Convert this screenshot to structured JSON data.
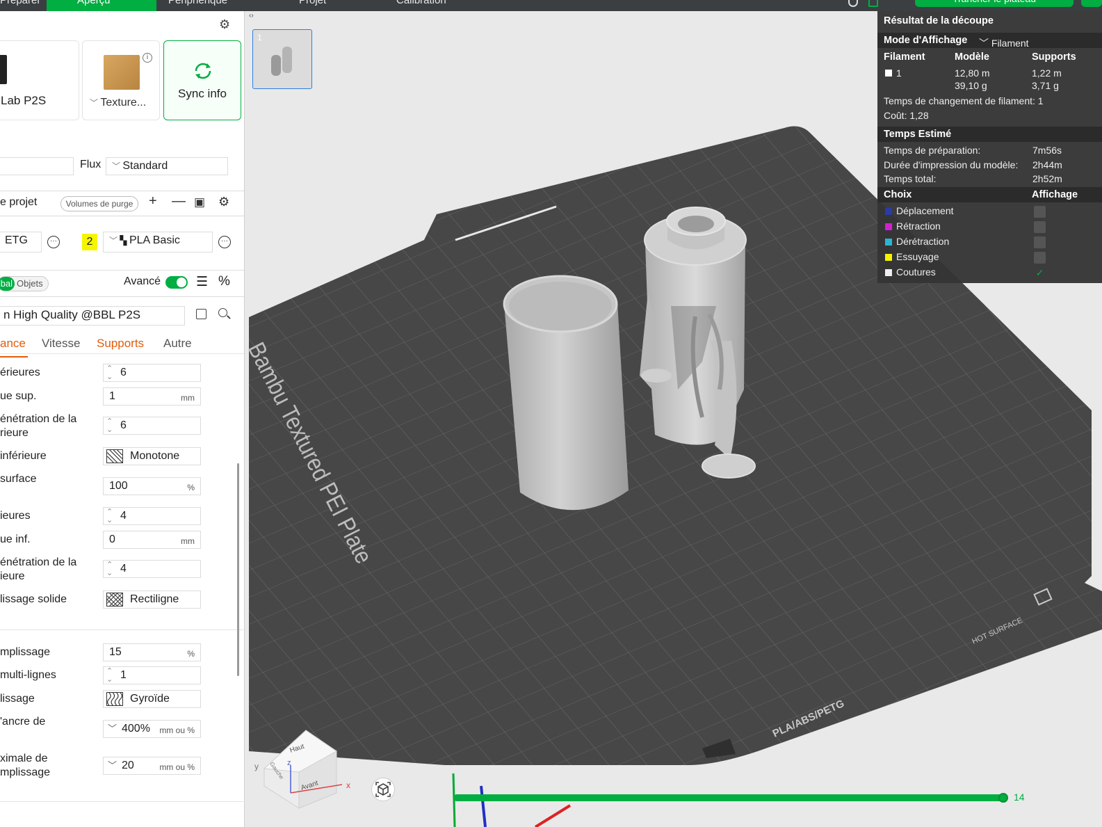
{
  "topbar": {
    "tabs": [
      {
        "label": "Préparer"
      },
      {
        "label": "Aperçu"
      },
      {
        "label": "Périphérique"
      },
      {
        "label": "Projet"
      },
      {
        "label": "Calibration"
      }
    ],
    "slice_button": "Trancher le plateau"
  },
  "printer": {
    "name": "Lab P2S",
    "plate": "Texture...",
    "sync": "Sync info"
  },
  "process": {
    "flux_label": "Flux",
    "flux_value": "Standard"
  },
  "filaments": {
    "header": "e projet",
    "purge_button": "Volumes de purge",
    "items": [
      {
        "label": "ETG"
      },
      {
        "num": "2",
        "label": "PLA Basic"
      }
    ]
  },
  "settings": {
    "scope_global": "bal",
    "scope_objects": "Objets",
    "advanced_label": "Avancé",
    "preset": "n High Quality @BBL P2S",
    "tabs": [
      "ance",
      "Vitesse",
      "Supports",
      "Autre"
    ],
    "params": [
      {
        "label": "érieures",
        "value": "6"
      },
      {
        "label": "ue sup.",
        "value": "1",
        "unit": "mm"
      },
      {
        "label": "énétration de la\nrieure",
        "value": "6"
      },
      {
        "label": "inférieure",
        "value": "Monotone"
      },
      {
        "label": "surface",
        "value": "100",
        "unit": "%"
      },
      {
        "label": "ieures",
        "value": "4"
      },
      {
        "label": "ue inf.",
        "value": "0",
        "unit": "mm"
      },
      {
        "label": "énétration de la\nieure",
        "value": "4"
      },
      {
        "label": "lissage solide",
        "value": "Rectiligne"
      },
      {
        "label": "mplissage",
        "value": "15",
        "unit": "%"
      },
      {
        "label": "multi-lignes",
        "value": "1"
      },
      {
        "label": "lissage",
        "value": "Gyroïde"
      },
      {
        "label": "'ancre de",
        "value": "400%",
        "unit": "mm ou %"
      },
      {
        "label": "ximale de\nmplissage",
        "value": "20",
        "unit": "mm ou %"
      }
    ]
  },
  "viewport": {
    "plate_number": "1",
    "bed_text": "Bambu Textured PEI Plate",
    "bed_text_2": "PLA/ABS/PETG",
    "bed_text_3": "HOT SURFACE",
    "cube_top": "Haut",
    "cube_front": "Avant",
    "cube_left": "Gauche",
    "axis_x": "x",
    "axis_y": "y",
    "axis_z": "z",
    "layer_value": "14"
  },
  "stats": {
    "title": "Résultat de la découpe",
    "mode_label": "Mode d'Affichage",
    "mode_value": "Filament",
    "col_filament": "Filament",
    "col_model": "Modèle",
    "col_supports": "Supports",
    "fil_id": "1",
    "model_len": "12,80 m",
    "model_weight": "39,10 g",
    "supp_len": "1,22 m",
    "supp_weight": "3,71 g",
    "change_time": "Temps de changement de filament: 1",
    "cost": "Coût: 1,28",
    "estimated_title": "Temps Estimé",
    "prep_label": "Temps de préparation:",
    "prep_value": "7m56s",
    "print_label": "Durée d'impression du modèle:",
    "print_value": "2h44m",
    "total_label": "Temps total:",
    "total_value": "2h52m",
    "choice_header": "Choix",
    "display_header": "Affichage",
    "legend": [
      {
        "label": "Déplacement",
        "color": "#2a3ba8",
        "checked": false
      },
      {
        "label": "Rétraction",
        "color": "#d21fd2",
        "checked": false
      },
      {
        "label": "Dérétraction",
        "color": "#29b6d2",
        "checked": false
      },
      {
        "label": "Essuyage",
        "color": "#f4f400",
        "checked": false
      },
      {
        "label": "Coutures",
        "color": "#eeeeee",
        "checked": true
      }
    ]
  },
  "colors": {
    "accent": "#00ae42",
    "warning": "#e35b0b"
  }
}
